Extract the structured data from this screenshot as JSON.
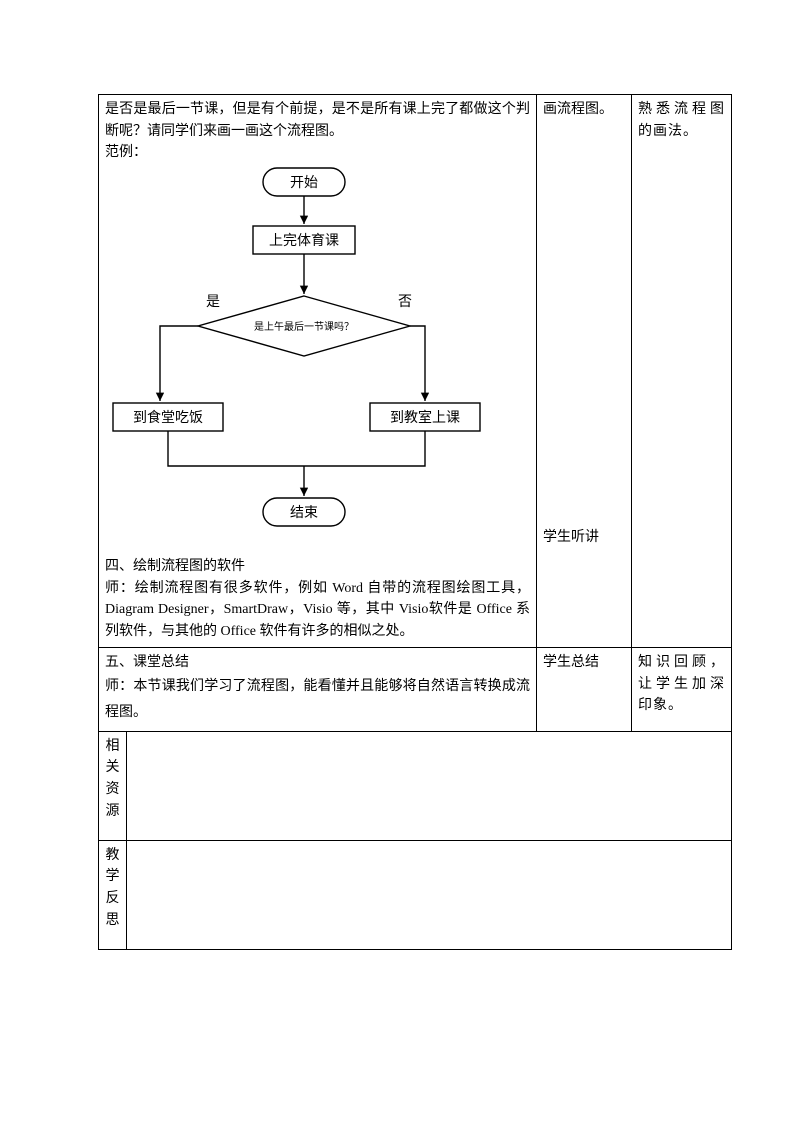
{
  "row1": {
    "main": {
      "para1": "是否是最后一节课，但是有个前提，是不是所有课上完了都做这个判断呢？请同学们来画一画这个流程图。",
      "example_label": "范例：",
      "flowchart": {
        "start": "开始",
        "step_after_class": "上完体育课",
        "decision": "是上午最后一节课吗？",
        "yes_label": "是",
        "no_label": "否",
        "branch_yes": "到食堂吃饭",
        "branch_no": "到教室上课",
        "end": "结束"
      },
      "section4_title": "四、绘制流程图的软件",
      "section4_body": "师：绘制流程图有很多软件，例如 Word 自带的流程图绘图工具，Diagram Designer，SmartDraw，Visio 等，其中 Visio软件是 Office 系列软件，与其他的 Office 软件有许多的相似之处。"
    },
    "side1_a": "画流程图。",
    "side1_b": "学生听讲",
    "side2": "熟悉流程图的画法。"
  },
  "row2": {
    "main_title": "五、课堂总结",
    "main_body": "师：本节课我们学习了流程图，能看懂并且能够将自然语言转换成流程图。",
    "side1": "学生总结",
    "side2": "知识回顾，让学生加深印象。"
  },
  "row3": {
    "label_chars": [
      "相",
      "关",
      "资",
      "源"
    ]
  },
  "row4": {
    "label_chars": [
      "教",
      "学",
      "反",
      "思"
    ]
  }
}
